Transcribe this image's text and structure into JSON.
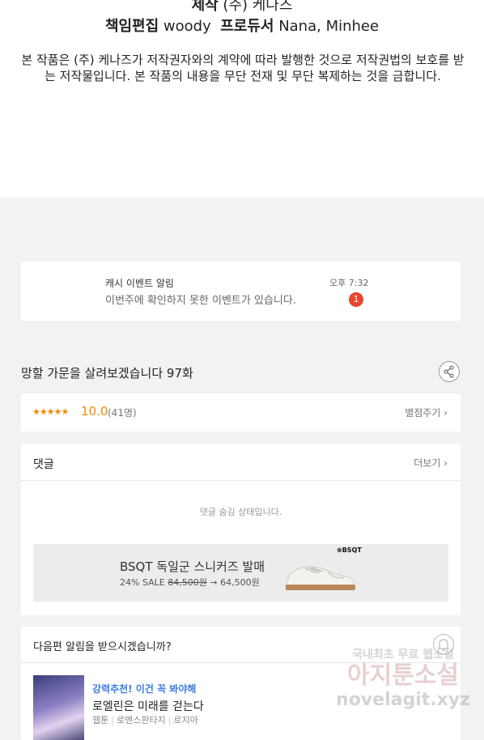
{
  "credits": {
    "production_label": "제작",
    "production_value": "(주) 케나즈",
    "editor_label": "책임편집",
    "editor_value": "woody",
    "producer_label": "프로듀서",
    "producer_value": "Nana, Minhee",
    "notice": "본 작품은 (주) 케나즈가 저작권자와의 계약에 따라 발행한 것으로 저작권법의 보호를 받는 저작물입니다. 본 작품의 내용을 무단 전재 및 무단 복제하는 것을 금합니다."
  },
  "cash_event": {
    "title": "캐시 이벤트 알림",
    "message": "이번주에 확인하지 못한 이벤트가 있습니다.",
    "time": "오후 7:32",
    "badge_count": "1"
  },
  "episode": {
    "title": "망할 가문을 살려보겠습니다 97화",
    "share_icon": "share-icon"
  },
  "rating": {
    "stars": "★★★★★",
    "score": "10.0",
    "count": "(41명)",
    "rate_button": "별점주기 ›",
    "color": "#f08c00"
  },
  "comments": {
    "label": "댓글",
    "more": "더보기 ›",
    "empty_message": "댓글 숨김 상태입니다."
  },
  "ad": {
    "brand": "⊕BSQT",
    "headline": "BSQT 독일군 스니커즈 발매",
    "discount": "24% SALE",
    "old_price": "84,500원",
    "arrow": "→",
    "new_price": "64,500원"
  },
  "next_alert": {
    "question": "다음편 알림을 받으시겠습니까?",
    "bell_icon": "bell-icon"
  },
  "recommendation": {
    "tagline": "강력추천! 이건 꼭 봐야해",
    "title": "로엘린은 미래를 걷는다",
    "tag1": "웹툰",
    "tag2": "로맨스판타지",
    "tag3": "로지아",
    "accent": "#3b7be0"
  },
  "watermark": {
    "line1": "국내최초 무료 웹소설",
    "line2": "아지툰소설",
    "line3": "novelagit.xyz"
  }
}
